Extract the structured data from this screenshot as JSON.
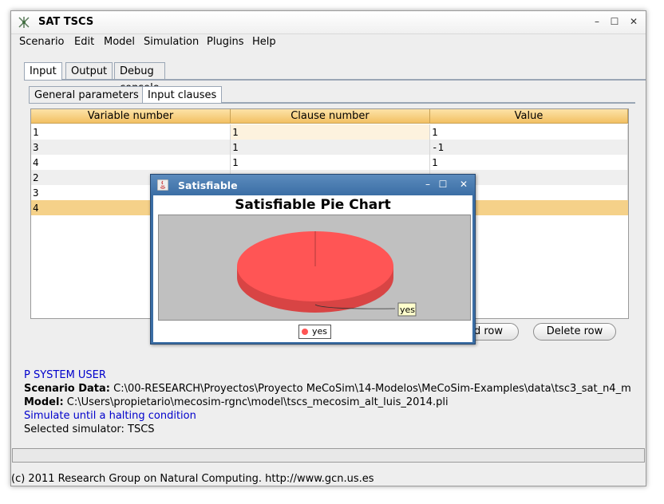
{
  "window": {
    "title": "SAT TSCS"
  },
  "menu": [
    "Scenario",
    "Edit",
    "Model",
    "Simulation",
    "Plugins",
    "Help"
  ],
  "tabs": [
    "Input",
    "Output",
    "Debug console"
  ],
  "subtabs": [
    "General parameters",
    "Input clauses"
  ],
  "table": {
    "headers": [
      "Variable number",
      "Clause number",
      "Value"
    ],
    "rows": [
      [
        "1",
        "1",
        "1"
      ],
      [
        "3",
        "1",
        "-1"
      ],
      [
        "4",
        "1",
        "1"
      ],
      [
        "2",
        "",
        ""
      ],
      [
        "3",
        "",
        ""
      ],
      [
        "4",
        "",
        ""
      ]
    ]
  },
  "buttons": {
    "add_row_partial": "d row",
    "delete_row": "Delete row"
  },
  "info": {
    "system": "P SYSTEM USER",
    "scenario_label": "Scenario Data:",
    "scenario_value": "C:\\00-RESEARCH\\Proyectos\\Proyecto MeCoSim\\14-Modelos\\MeCoSim-Examples\\data\\tsc3_sat_n4_m",
    "model_label": "Model:",
    "model_value": "C:\\Users\\propietario\\mecosim-rgnc\\model\\tscs_mecosim_alt_luis_2014.pli",
    "simulate": "Simulate until a halting condition",
    "selected": "Selected simulator: TSCS"
  },
  "status": "(c) 2011 Research Group on Natural Computing. http://www.gcn.us.es",
  "dialog": {
    "title": "Satisfiable"
  },
  "chart_data": {
    "type": "pie",
    "title": "Satisfiable Pie Chart",
    "categories": [
      "yes"
    ],
    "values": [
      100
    ],
    "colors": [
      "#ff5555"
    ],
    "legend": "bottom"
  }
}
